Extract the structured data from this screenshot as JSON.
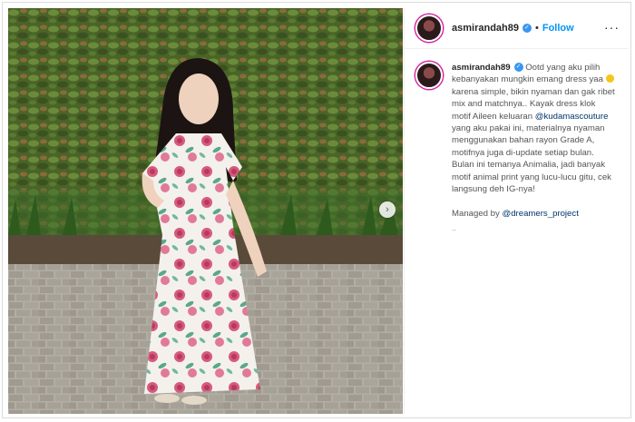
{
  "post": {
    "username": "asmirandah89",
    "follow_label": "Follow",
    "separator": "•",
    "more_label": "···",
    "verified_glyph": "✓",
    "next_glyph": "›"
  },
  "caption": {
    "username": "asmirandah89",
    "text_1": " Ootd yang aku pilih kebanyakan mungkin emang dress yaa ",
    "emoji": "grinning-face-emoji",
    "text_2": " karena simple, bikin nyaman dan gak ribet mix and matchnya.. Kayak dress klok motif Aileen keluaran ",
    "mention_1": "@kudamascouture",
    "text_3": " yang aku pakai ini, materialnya nyaman menggunakan bahan rayon Grade A, motifnya juga di-update setiap bulan. Bulan ini temanya Animalia, jadi banyak motif animal print yang lucu-lucu gitu, cek langsung deh IG-nya!",
    "managed_prefix": "Managed by ",
    "mention_2": "@dreamers_project",
    "trailing": "–"
  },
  "colors": {
    "follow_blue": "#0095f6",
    "verified_blue": "#3897f0",
    "mention": "#00376b",
    "hedge_green": "#4f6b2e",
    "paving": "#a8a49c"
  }
}
